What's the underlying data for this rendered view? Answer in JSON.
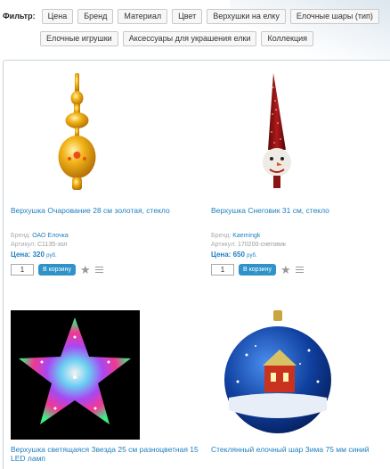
{
  "filter": {
    "label": "Фильтр:",
    "chips_row1": [
      "Цена",
      "Бренд",
      "Материал",
      "Цвет",
      "Верхушки на елку",
      "Елочные шары (тип)"
    ],
    "chips_row2": [
      "Елочные игрушки",
      "Аксессуары для украшения елки",
      "Коллекция"
    ]
  },
  "products": [
    {
      "title": "Верхушка Очарование 28 см золотая, стекло",
      "brand_label": "Бренд:",
      "brand": "ОАО Елочка",
      "sku_label": "Артикул:",
      "sku": "С1135-зол",
      "price_label": "Цена:",
      "price": "320",
      "currency": "руб.",
      "qty": "1",
      "cart_label": "В корзину"
    },
    {
      "title": "Верхушка Снеговик 31 см, стекло",
      "brand_label": "Бренд:",
      "brand": "Kaemingk",
      "sku_label": "Артикул:",
      "sku": "170200-снеговик",
      "price_label": "Цена:",
      "price": "650",
      "currency": "руб.",
      "qty": "1",
      "cart_label": "В корзину"
    },
    {
      "title": "Верхушка светящаяся Звезда 25 см разноцветная 15 LED ламп"
    },
    {
      "title": "Стеклянный елочный шар Зима 75 мм синий"
    }
  ],
  "colors": {
    "link": "#1e7fbf",
    "button": "#2f93c9"
  }
}
